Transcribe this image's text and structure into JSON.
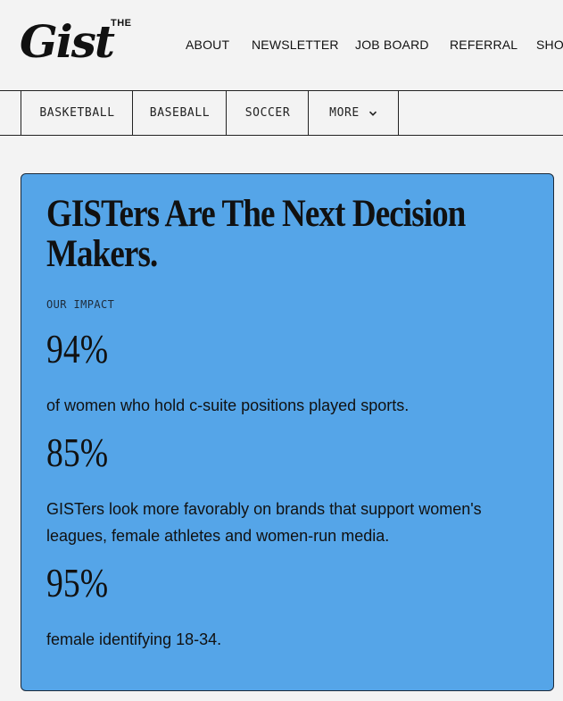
{
  "header": {
    "logo_the": "THE",
    "logo_word": "Gist",
    "nav": [
      {
        "label": "ABOUT"
      },
      {
        "label": "NEWSLETTER"
      },
      {
        "label": "JOB BOARD"
      },
      {
        "label": "REFERRAL"
      },
      {
        "label": "SHO"
      }
    ]
  },
  "tabs": [
    {
      "label": "BASKETBALL"
    },
    {
      "label": "BASEBALL"
    },
    {
      "label": "SOCCER"
    },
    {
      "label": "MORE",
      "icon": "chevron-down-icon"
    }
  ],
  "card": {
    "title": "GISTers Are The Next Decision Makers.",
    "eyebrow": "OUR IMPACT",
    "stats": [
      {
        "value": "94%",
        "description": "of women who hold c-suite positions played sports."
      },
      {
        "value": "85%",
        "description": "GISTers look more favorably on brands that support women's leagues, female athletes and women-run media."
      },
      {
        "value": "95%",
        "description": "female identifying 18-34."
      }
    ],
    "background_color": "#55a5e8"
  }
}
